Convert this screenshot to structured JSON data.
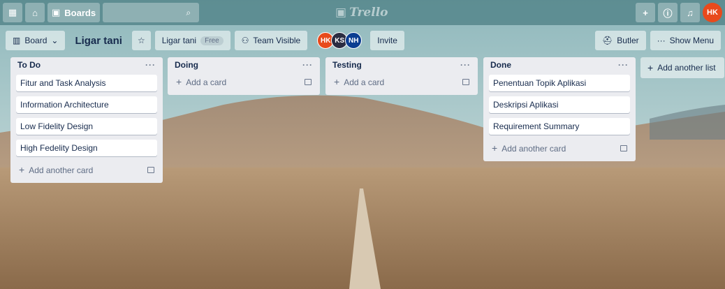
{
  "topbar": {
    "boards_label": "Boards",
    "logo_text": "Trello",
    "user_initials": "HK"
  },
  "board": {
    "view_label": "Board",
    "title": "Ligar tani",
    "team_name": "Ligar tani",
    "plan_badge": "Free",
    "visibility_label": "Team Visible",
    "invite_label": "Invite",
    "butler_label": "Butler",
    "menu_label": "Show Menu",
    "members": [
      {
        "initials": "HK",
        "color": "#e84a1c"
      },
      {
        "initials": "KS",
        "color": "#2b2d42"
      },
      {
        "initials": "NH",
        "color": "#0b3d91"
      }
    ]
  },
  "lists": [
    {
      "title": "To Do",
      "cards": [
        "Fitur and Task Analysis",
        "Information Architecture",
        "Low Fidelity Design",
        "High Fedelity Design"
      ],
      "add_label": "Add another card"
    },
    {
      "title": "Doing",
      "cards": [],
      "add_label": "Add a card"
    },
    {
      "title": "Testing",
      "cards": [],
      "add_label": "Add a card"
    },
    {
      "title": "Done",
      "cards": [
        "Penentuan Topik Aplikasi",
        "Deskripsi Aplikasi",
        "Requirement Summary"
      ],
      "add_label": "Add another card"
    }
  ],
  "add_list_label": "Add another list"
}
